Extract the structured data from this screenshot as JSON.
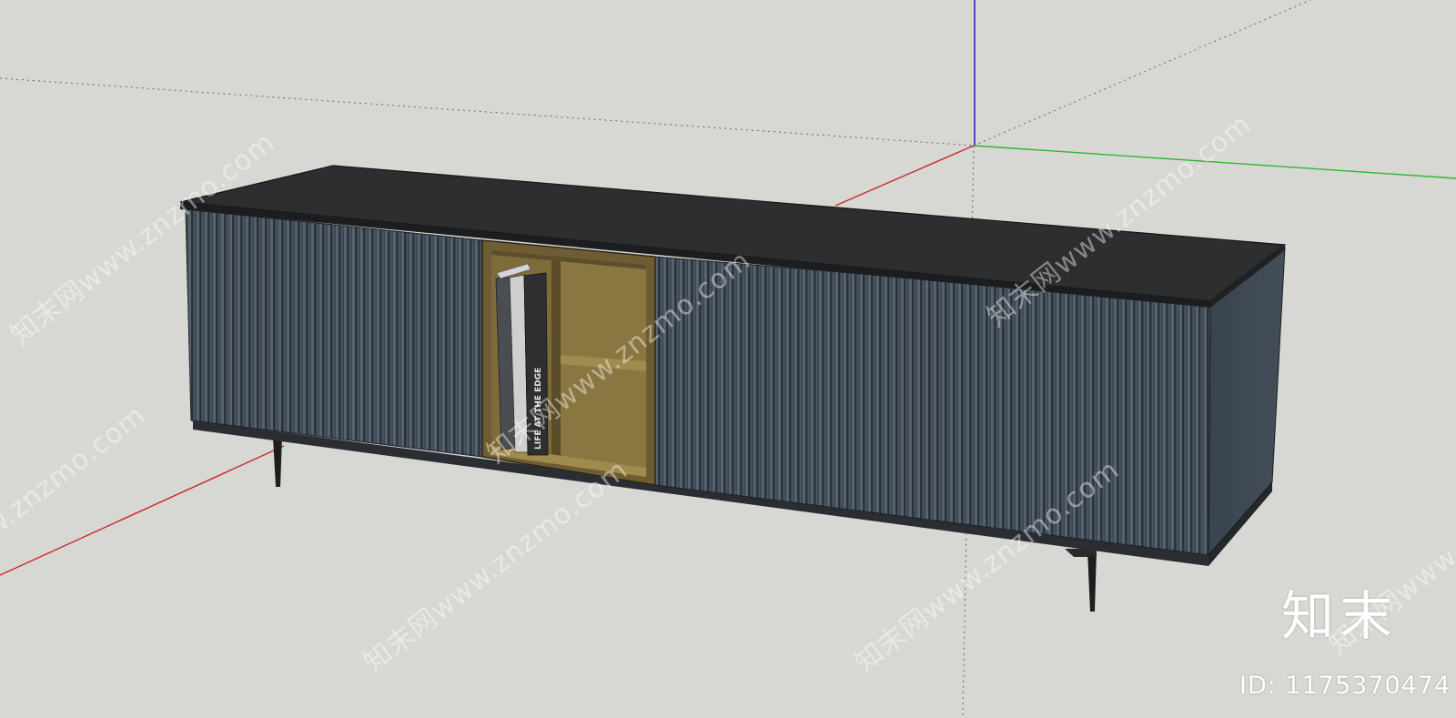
{
  "viewport": {
    "background": "#d7d7d3",
    "axes": {
      "x_axis_color": "#cc2a2a",
      "y_axis_color": "#2fb52f",
      "z_axis_color": "#2a2ad0",
      "hidden_axis_color": "#555555"
    }
  },
  "model": {
    "name": "sideboard-cabinet",
    "top_color": "#2d2e30",
    "panel_color": "#3d4752",
    "rib_color": "#5d6a76",
    "shelf_color": "#8e7a45",
    "shelf_dark": "#6e5d32",
    "legs_color": "#1e1e1e",
    "book_spine_text": "LIFE AT THE EDGE"
  },
  "watermarks": {
    "text": "知末网www.znzmo.com",
    "logo": "知末",
    "id_text": "ID: 1175370474"
  }
}
